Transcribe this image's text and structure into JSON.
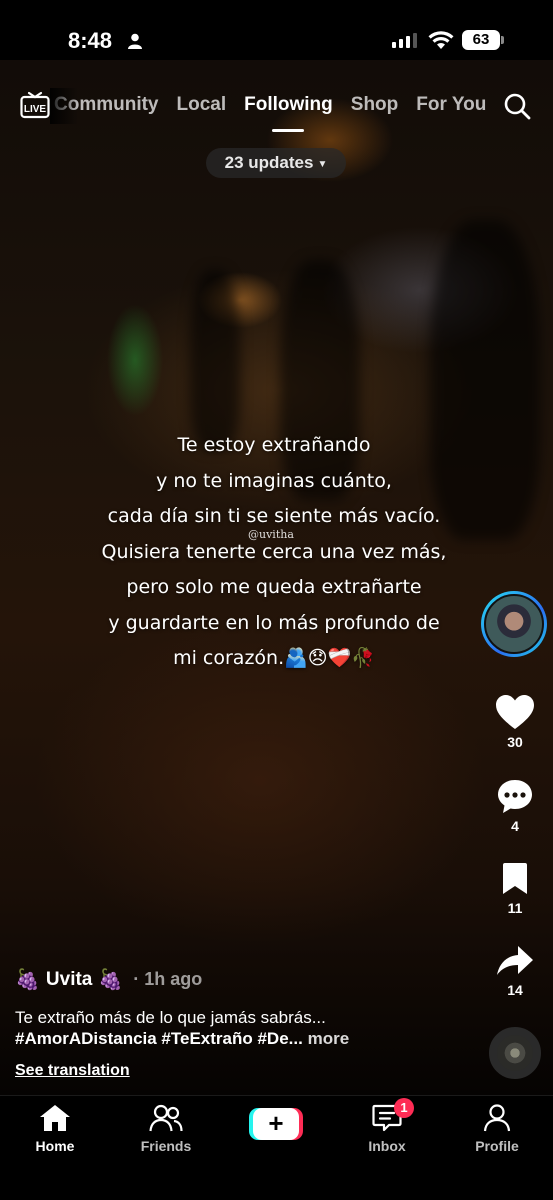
{
  "status_bar": {
    "time": "8:48",
    "battery": "63"
  },
  "top_nav": {
    "live_label": "LIVE",
    "tabs": [
      {
        "label": "Community"
      },
      {
        "label": "Local"
      },
      {
        "label": "Following"
      },
      {
        "label": "Shop"
      },
      {
        "label": "For You"
      }
    ],
    "active_tab": "Following"
  },
  "updates_pill": {
    "label": "23 updates"
  },
  "video_overlay": {
    "lines": [
      "Te estoy extrañando",
      "y no te imaginas cuánto,",
      "cada día sin ti se siente más vacío.",
      "Quisiera tenerte cerca una vez más,",
      "pero solo me queda extrañarte",
      "y guardarte en lo más profundo de",
      "mi corazón.🫂😞❤️‍🩹🥀"
    ],
    "watermark": "@uvitha"
  },
  "actions": {
    "likes": "30",
    "comments": "4",
    "bookmarks": "11",
    "shares": "14"
  },
  "post": {
    "author_prefix_emoji": "🍇",
    "author": "Uvita",
    "author_suffix_emoji": "🍇",
    "time": "· 1h ago",
    "caption": "Te extraño más de lo que jamás sabrás...",
    "hashtags": "#AmorADistancia #TeExtraño #De...",
    "more_label": "more",
    "translation_label": "See translation"
  },
  "tab_bar": {
    "home": "Home",
    "friends": "Friends",
    "inbox": "Inbox",
    "inbox_badge": "1",
    "profile": "Profile",
    "create_symbol": "+"
  },
  "colors": {
    "accent_cyan": "#25f4ee",
    "accent_red": "#fe2c55",
    "avatar_ring": "#27e0f0"
  },
  "icons": [
    "live-icon",
    "search-icon",
    "heart-icon",
    "comment-icon",
    "bookmark-icon",
    "share-icon",
    "home-icon",
    "friends-icon",
    "inbox-icon",
    "profile-icon"
  ]
}
